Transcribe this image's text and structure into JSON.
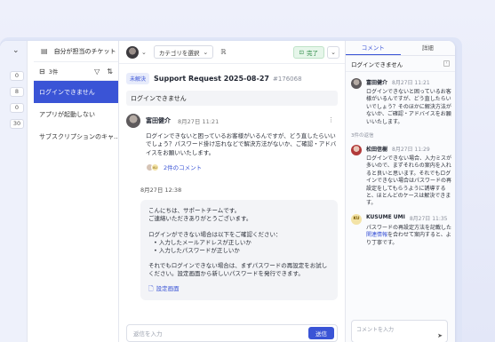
{
  "counts": [
    "0",
    "8",
    "0",
    "30"
  ],
  "list": {
    "header": "自分が担当のチケット",
    "count_label": "3件",
    "tickets": [
      "ログインできません",
      "アプリが起動しない",
      "サブスクリプションのキャ..."
    ]
  },
  "toolbar": {
    "category_placeholder": "カテゴリを選択",
    "done_label": "完了"
  },
  "ticket": {
    "status": "未解決",
    "title": "Support Request 2025-08-27",
    "number": "#176068",
    "subject": "ログインできません"
  },
  "message": {
    "author": "富田健介",
    "date": "8月27日 11:21",
    "body": "ログインできないと困っているお客様がいるんですが、どう直したらいいでしょう？パスワード掛け忘れなどで解決方法がないか、ご確認・アドバイスをお願いいたします。",
    "comment_link": "2件のコメント",
    "mini_avatar": "KU"
  },
  "reply": {
    "date_label": "8月27日 12:38",
    "greeting": "こんにちは、サポートチームです。",
    "thanks": "ご連絡いただきありがとうございます。",
    "intro": "ログインができない場合は以下をご確認ください：",
    "bullet1": "• 入力したメールアドレスが正しいか",
    "bullet2": "• 入力したパスワードが正しいか",
    "closing": "それでもログインできない場合は、まずパスワードの再設定をお試しください。設定画面から新しいパスワードを発行できます。",
    "attachment": "設定画面"
  },
  "composer": {
    "placeholder": "返信を入力",
    "send_label": "送信"
  },
  "side": {
    "tabs": [
      "コメント",
      "詳細"
    ],
    "header": "ログインできません",
    "separator": "3件の返信",
    "comments": [
      {
        "author": "富田健介",
        "time": "8月27日 11:21",
        "text": "ログインできないと困っているお客様がいるんですが、どう直したらいいでしょう？そのほかに解決方法がないか、ご確認・アドバイスをお願いいたします。"
      },
      {
        "author": "松田信樹",
        "time": "8月27日 11:29",
        "text": "ログインできない場合、入力ミスが多いので、まずそれらの案内を入れると良いと思います。それでもログインできない場合はパスワードの再設定をしてもらうように誘導すると、ほとんどのケースは解決できます。"
      },
      {
        "author": "KUSUME UMI",
        "time": "8月27日 11:35",
        "avatar": "KU",
        "text_link": "関連情報",
        "text_pre": "パスワードの再設定方法を記載した",
        "text_post": "を合わせて案内すると、より丁寧です。"
      }
    ],
    "composer_placeholder": "コメントを入力"
  },
  "colors": {
    "accent": "#3a54d6",
    "done": "#2a8a44"
  }
}
